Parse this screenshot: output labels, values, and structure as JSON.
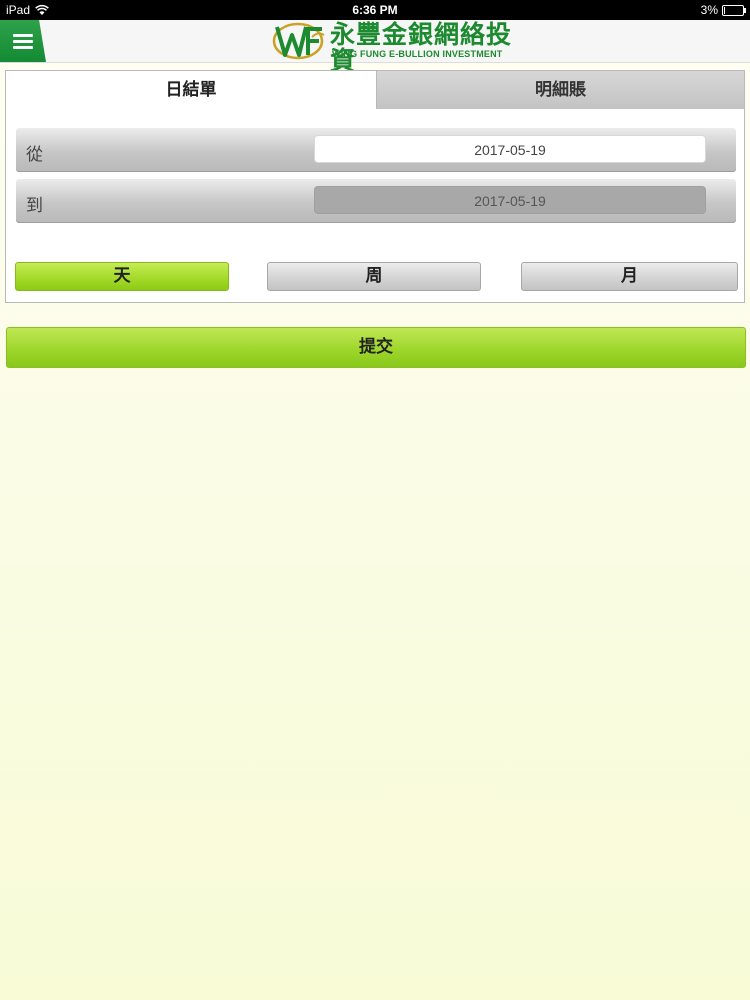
{
  "status_bar": {
    "device": "iPad",
    "time": "6:36 PM",
    "battery": "3%",
    "battery_level": 0.03
  },
  "header": {
    "menu_icon": "hamburger-menu-icon",
    "logo_cn": "永豐金銀網絡投資",
    "logo_en": "WING FUNG E-BULLION INVESTMENT",
    "brand_color": "#1c8a2e",
    "logo_accent": "#c9a227"
  },
  "tabs": [
    {
      "label": "日結單",
      "active": true
    },
    {
      "label": "明細賬",
      "active": false
    }
  ],
  "date_range": {
    "from_label": "從",
    "from_value": "2017-05-19",
    "to_label": "到",
    "to_value": "2017-05-19",
    "to_disabled": true
  },
  "periods": [
    {
      "label": "天",
      "active": true
    },
    {
      "label": "周",
      "active": false
    },
    {
      "label": "月",
      "active": false
    }
  ],
  "submit_label": "提交",
  "colors": {
    "accent_green": "#9fd62c",
    "menu_green": "#138a33"
  }
}
